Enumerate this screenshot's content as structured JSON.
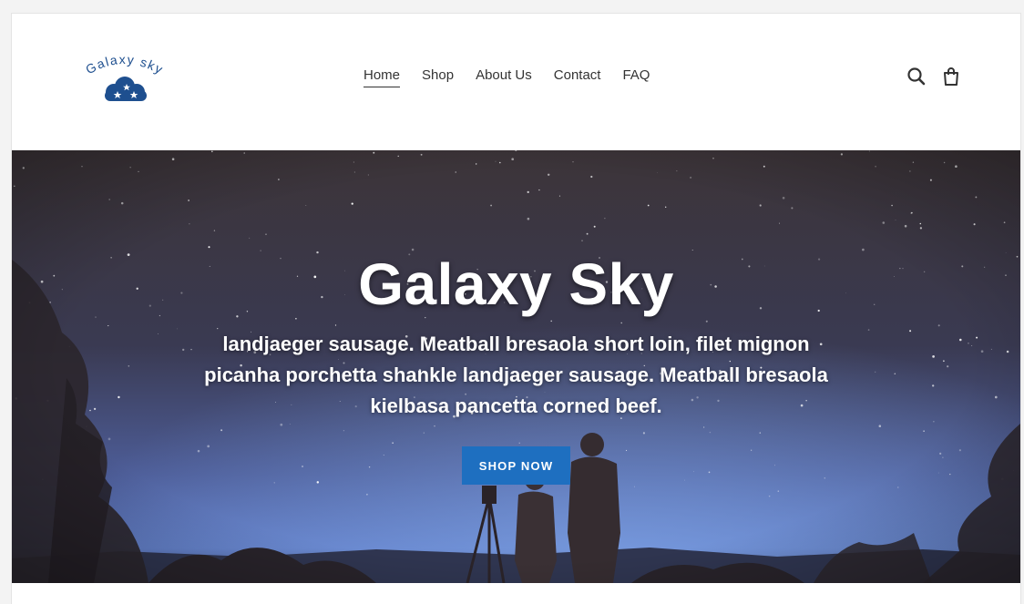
{
  "brand": {
    "logo_text": "Galaxy sky",
    "accent": "#1e4f8f"
  },
  "nav": {
    "items": [
      {
        "label": "Home",
        "active": true
      },
      {
        "label": "Shop"
      },
      {
        "label": "About Us"
      },
      {
        "label": "Contact"
      },
      {
        "label": "FAQ"
      }
    ]
  },
  "header_icons": [
    "search-icon",
    "cart-icon"
  ],
  "hero": {
    "title": "Galaxy Sky",
    "text": "landjaeger sausage. Meatball bresaola short loin, filet mignon picanha porchetta shankle landjaeger sausage. Meatball bresaola kielbasa pancetta corned beef.",
    "button_label": "SHOP NOW",
    "button_color": "#1e6fc0"
  }
}
